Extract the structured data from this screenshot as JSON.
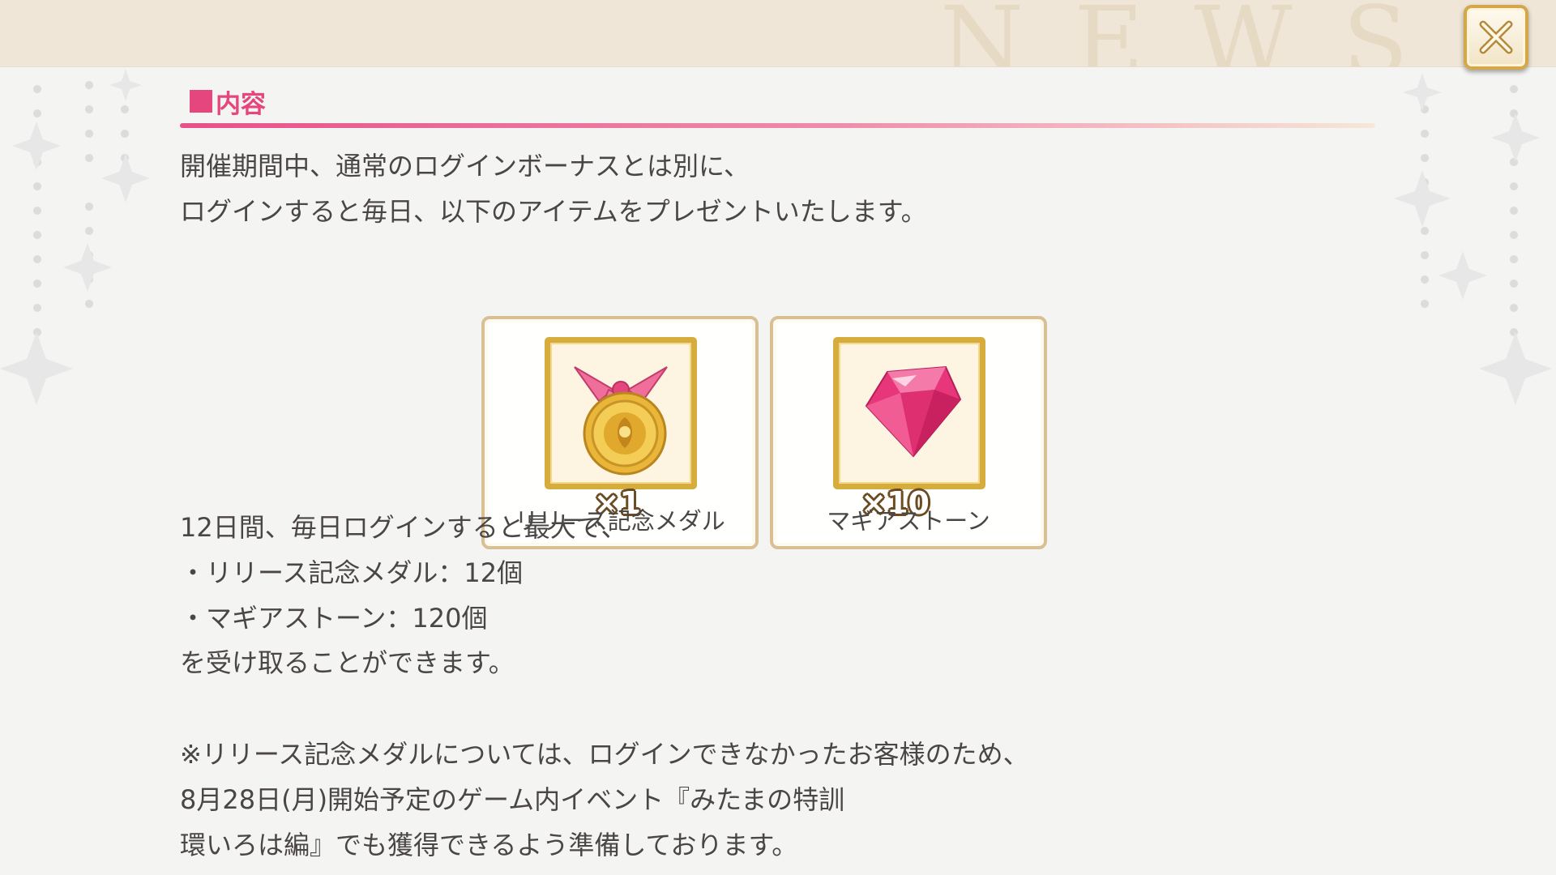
{
  "header": {
    "watermark": "NEWS",
    "close_label": "×"
  },
  "section": {
    "title": "内容"
  },
  "intro": [
    "開催期間中、通常のログインボーナスとは別に、",
    "ログインすると毎日、以下のアイテムをプレゼントいたします。"
  ],
  "items": [
    {
      "name": "リリース記念メダル",
      "quantity": "×1",
      "icon": "medal-icon"
    },
    {
      "name": "マギアストーン",
      "quantity": "×10",
      "icon": "gem-icon"
    }
  ],
  "summary": [
    "12日間、毎日ログインすると最大で、",
    "・リリース記念メダル：12個",
    "・マギアストーン：120個",
    "を受け取ることができます。"
  ],
  "note": [
    "※リリース記念メダルについては、ログインできなかったお客様のため、",
    "8月28日(月)開始予定のゲーム内イベント『みたまの特訓",
    "環いろは編』でも獲得できるよう準備しております。"
  ],
  "colors": {
    "accent": "#e5467d",
    "header_bg": "#efe6d7",
    "card_border": "#d8bf94",
    "gold": "#d6ad3c"
  }
}
